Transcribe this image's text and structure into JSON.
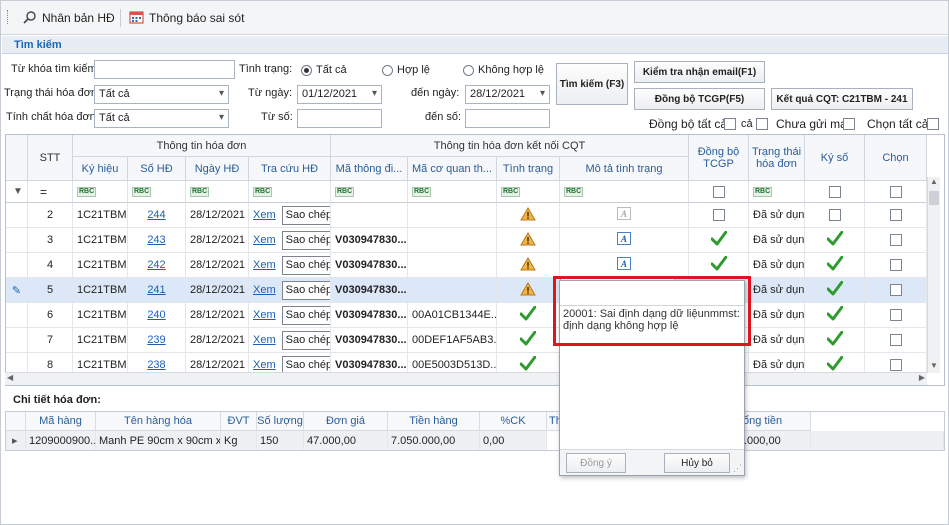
{
  "toolbar": {
    "btn1": "Nhân bản HĐ",
    "btn2": "Thông báo sai sót"
  },
  "search": {
    "group_title": "Tìm kiếm",
    "keyword_label": "Từ khóa tìm kiếm:",
    "status_label": "Tình trạng:",
    "r_all": "Tất cả",
    "r_valid": "Hợp lệ",
    "r_invalid": "Không hợp lệ",
    "invoice_state_label": "Trạng thái hóa đơn:",
    "invoice_state_val": "Tất cả",
    "from_date_label": "Từ ngày:",
    "from_date_val": "01/12/2021",
    "to_date_label": "đến ngày:",
    "to_date_val": "28/12/2021",
    "nature_label": "Tính chất hóa đơn:",
    "nature_val": "Tất cả",
    "from_no_label": "Từ số:",
    "to_no_label": "đến số:",
    "btn_search": "Tìm kiếm (F3)",
    "btn_check_email": "Kiểm tra nhận email(F1)",
    "btn_sync": "Đồng bộ TCGP(F5)",
    "btn_result": "Kết quả CQT: C21TBM - 241",
    "sync_all": "Đồng bộ tất cả",
    "ca": "cả",
    "no_mail": "Chưa gửi mail",
    "select_all": "Chọn tất cả"
  },
  "grid": {
    "h_stt": "STT",
    "h_info": "Thông tin hóa đơn",
    "h_cqt": "Thông tin hóa đơn kết nối CQT",
    "h_sync": "Đồng bộ TCGP",
    "h_state": "Trạng thái hóa đơn",
    "h_sign": "Ký số",
    "h_pick": "Chọn",
    "h_kh": "Ký hiệu",
    "h_so": "Số HĐ",
    "h_ngay": "Ngày HĐ",
    "h_tra": "Tra cứu HĐ",
    "h_ma": "Mã thông đi...",
    "h_macq": "Mã cơ quan th...",
    "h_tt": "Tình trạng",
    "h_mota": "Mô tả tình trạng",
    "filter_eq": "=",
    "rbc": "RBC",
    "rows": [
      {
        "stt": "2",
        "kh": "1C21TBM",
        "so": "244",
        "ngay": "28/12/2021",
        "xem": "Xem",
        "copy": "Sao chép",
        "ma": "",
        "macq": "",
        "state": "Đã sử dụng"
      },
      {
        "stt": "3",
        "kh": "1C21TBM",
        "so": "243",
        "ngay": "28/12/2021",
        "xem": "Xem",
        "copy": "Sao chép",
        "ma": "V030947830...",
        "macq": "",
        "state": "Đã sử dụng"
      },
      {
        "stt": "4",
        "kh": "1C21TBM",
        "so": "242",
        "ngay": "28/12/2021",
        "xem": "Xem",
        "copy": "Sao chép",
        "ma": "V030947830...",
        "macq": "",
        "state": "Đã sử dụng"
      },
      {
        "stt": "5",
        "kh": "1C21TBM",
        "so": "241",
        "ngay": "28/12/2021",
        "xem": "Xem",
        "copy": "Sao chép",
        "ma": "V030947830...",
        "macq": "",
        "state": "Đã sử dụng"
      },
      {
        "stt": "6",
        "kh": "1C21TBM",
        "so": "240",
        "ngay": "28/12/2021",
        "xem": "Xem",
        "copy": "Sao chép",
        "ma": "V030947830...",
        "macq": "00A01CB1344E...",
        "state": "Đã sử dụng"
      },
      {
        "stt": "7",
        "kh": "1C21TBM",
        "so": "239",
        "ngay": "28/12/2021",
        "xem": "Xem",
        "copy": "Sao chép",
        "ma": "V030947830...",
        "macq": "00DEF1AF5AB3...",
        "state": "Đã sử dụng"
      },
      {
        "stt": "8",
        "kh": "1C21TBM",
        "so": "238",
        "ngay": "28/12/2021",
        "xem": "Xem",
        "copy": "Sao chép",
        "ma": "V030947830...",
        "macq": "00E5003D513D...",
        "state": "Đã sử dụng"
      }
    ]
  },
  "detail": {
    "title": "Chi tiết hóa đơn:",
    "h_ma": "Mã hàng",
    "h_ten": "Tên hàng hóa",
    "h_dvt": "ĐVT",
    "h_sl": "Số lượng",
    "h_dg": "Đơn giá",
    "h_th": "Tiền hàng",
    "h_ck": "%CK",
    "h_th2": "Th",
    "h_tong": "ổng tiền",
    "r_ma": "1209000900...",
    "r_ten": "Manh PE 90cm x 90cm x...",
    "r_dvt": "Kg",
    "r_sl": "150",
    "r_dg": "47.000,00",
    "r_th": "7.050.000,00",
    "r_ck": "0,00",
    "r_tong": ".000,00"
  },
  "popup": {
    "text": "20001: Sai định dạng dữ liệunmmst: định dạng không hợp lệ",
    "ok": "Đồng ý",
    "cancel": "Hủy bỏ"
  },
  "colors": {
    "accent": "#1a66b8",
    "green": "#2e9b2e",
    "warn": "#e6a12a",
    "red": "#e0141e",
    "selrow": "#dce8f7"
  }
}
